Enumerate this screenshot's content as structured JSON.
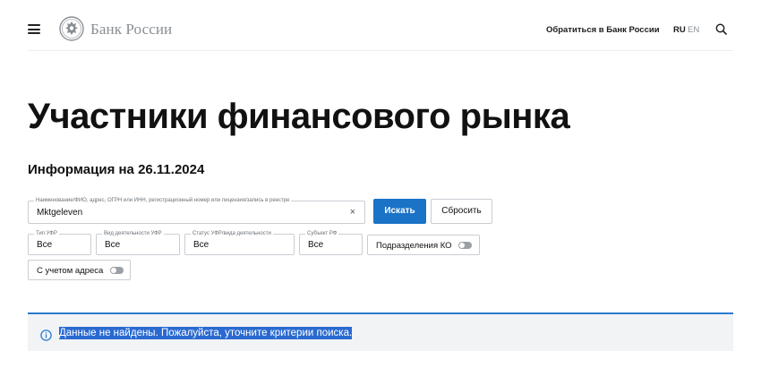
{
  "header": {
    "logo_text": "Банк России",
    "contact_link": "Обратиться в Банк России",
    "lang_ru": "RU",
    "lang_en": "EN",
    "icons": [
      "menu-icon",
      "bank-emblem-icon",
      "search-icon"
    ]
  },
  "page": {
    "title": "Участники финансового рынка",
    "info_date": "Информация на 26.11.2024"
  },
  "search": {
    "main_field": {
      "legend": "Наименование/ФИО, адрес, ОГРН или ИНН, регистрационный номер или лицензия/запись в реестре",
      "value": "Mktgeleven",
      "clear_symbol": "×"
    },
    "search_button": "Искать",
    "reset_button": "Сбросить",
    "filters": [
      {
        "legend": "Тип УФР",
        "value": "Все"
      },
      {
        "legend": "Вид деятельности УФР",
        "value": "Все"
      },
      {
        "legend": "Статус УФР/вида деятельности",
        "value": "Все"
      },
      {
        "legend": "Субъект РФ",
        "value": "Все"
      }
    ],
    "toggles": {
      "ko_divisions": {
        "label": "Подразделения КО",
        "on": false
      },
      "with_address": {
        "label": "С учетом адреса",
        "on": false
      }
    }
  },
  "alert": {
    "text": "Данные не найдены. Пожалуйста, уточните критерии поиска.",
    "icon": "info-icon"
  },
  "colors": {
    "accent": "#1a73c7",
    "alert_border": "#2a7ccf",
    "alert_bg": "#f2f3f5",
    "selection": "#2a6ad0",
    "muted": "#8a8f94"
  }
}
